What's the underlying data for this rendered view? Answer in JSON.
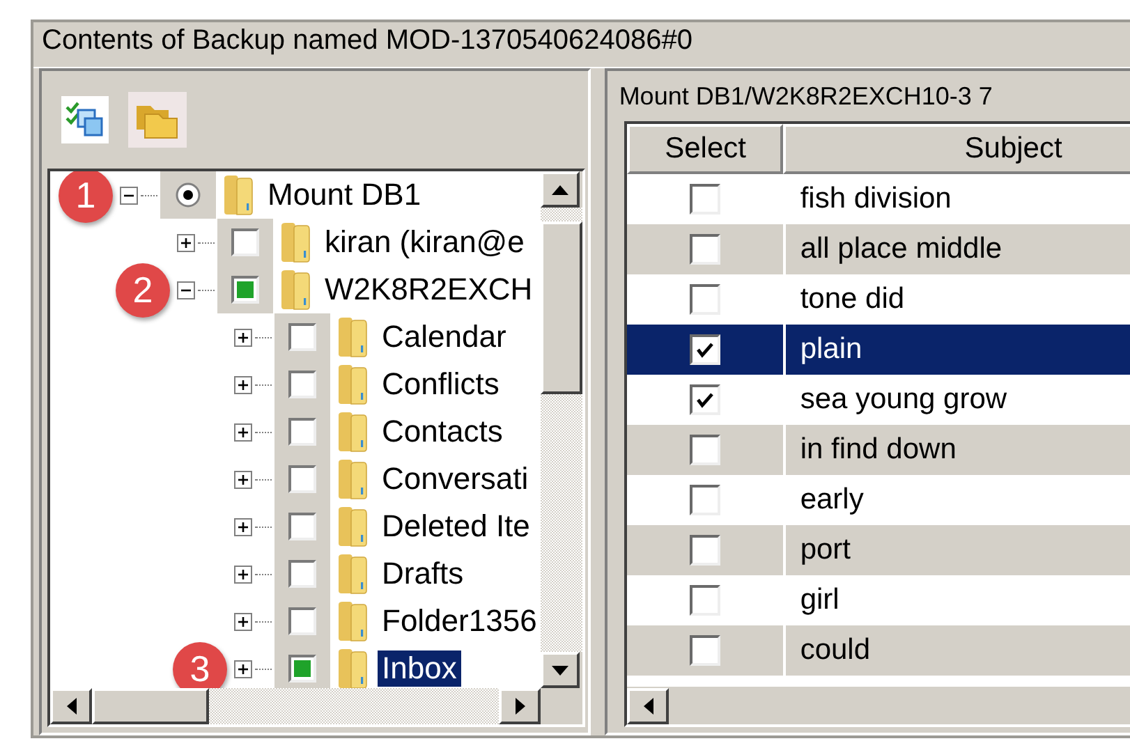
{
  "window": {
    "title": "Contents of Backup named MOD-1370540624086#0"
  },
  "tree": {
    "items": [
      {
        "label": "Mount DB1",
        "kind": "radio",
        "checked": true,
        "expanded": true,
        "selected": false,
        "callout": "1",
        "children": [
          {
            "label": "kiran (kiran@e",
            "kind": "checkbox",
            "checked": false,
            "expanded": false,
            "selected": false
          },
          {
            "label": "W2K8R2EXCH",
            "kind": "checkbox",
            "checked": true,
            "expanded": true,
            "selected": false,
            "callout": "2",
            "children": [
              {
                "label": "Calendar",
                "kind": "checkbox",
                "checked": false,
                "expanded": false,
                "selected": false
              },
              {
                "label": "Conflicts",
                "kind": "checkbox",
                "checked": false,
                "expanded": false,
                "selected": false
              },
              {
                "label": "Contacts",
                "kind": "checkbox",
                "checked": false,
                "expanded": false,
                "selected": false
              },
              {
                "label": "Conversati",
                "kind": "checkbox",
                "checked": false,
                "expanded": false,
                "selected": false
              },
              {
                "label": "Deleted Ite",
                "kind": "checkbox",
                "checked": false,
                "expanded": false,
                "selected": false
              },
              {
                "label": "Drafts",
                "kind": "checkbox",
                "checked": false,
                "expanded": false,
                "selected": false
              },
              {
                "label": "Folder1356",
                "kind": "checkbox",
                "checked": false,
                "expanded": false,
                "selected": false
              },
              {
                "label": "Inbox",
                "kind": "checkbox",
                "checked": true,
                "expanded": false,
                "selected": true,
                "callout": "3"
              }
            ]
          }
        ]
      }
    ]
  },
  "messages": {
    "title": "Mount DB1/W2K8R2EXCH10-3 7",
    "columns": [
      "Select",
      "Subject"
    ],
    "rows": [
      {
        "subject": "fish division",
        "checked": false,
        "selected": false
      },
      {
        "subject": "all place middle",
        "checked": false,
        "selected": false
      },
      {
        "subject": "tone did",
        "checked": false,
        "selected": false
      },
      {
        "subject": "plain",
        "checked": true,
        "selected": true
      },
      {
        "subject": "sea young grow",
        "checked": true,
        "selected": false
      },
      {
        "subject": "in find down",
        "checked": false,
        "selected": false
      },
      {
        "subject": "early",
        "checked": false,
        "selected": false
      },
      {
        "subject": "port",
        "checked": false,
        "selected": false
      },
      {
        "subject": "girl",
        "checked": false,
        "selected": false
      },
      {
        "subject": "could",
        "checked": false,
        "selected": false
      }
    ]
  }
}
